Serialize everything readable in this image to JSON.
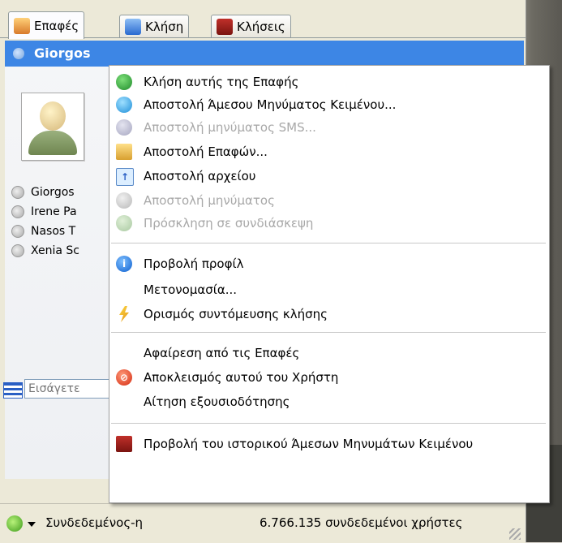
{
  "tabs": [
    {
      "label": "Επαφές",
      "icon": "contacts-icon",
      "active": true
    },
    {
      "label": "Κλήση",
      "icon": "dialpad-icon",
      "active": false
    },
    {
      "label": "Κλήσεις",
      "icon": "call-history-icon",
      "active": false
    }
  ],
  "selected_contact": "Giorgos",
  "contacts": [
    "Giorgos",
    "Irene Pa",
    "Nasos T",
    "Xenia Sc"
  ],
  "search": {
    "placeholder": "Εισάγετε"
  },
  "context_menu": {
    "items": [
      {
        "label": "Κλήση αυτής της Επαφής",
        "icon": "call-icon",
        "enabled": true
      },
      {
        "label": "Αποστολή Άμεσου Μηνύματος Κειμένου...",
        "icon": "chat-icon",
        "enabled": true
      },
      {
        "label": "Αποστολή μηνύματος SMS...",
        "icon": "sms-icon",
        "enabled": false
      },
      {
        "label": "Αποστολή Επαφών...",
        "icon": "send-contacts-icon",
        "enabled": true
      },
      {
        "label": "Αποστολή αρχείου",
        "icon": "send-file-icon",
        "enabled": true
      },
      {
        "label": "Αποστολή μηνύματος",
        "icon": "voicemail-icon",
        "enabled": false
      },
      {
        "label": "Πρόσκληση σε συνδιάσκεψη",
        "icon": "conference-icon",
        "enabled": false
      },
      {
        "label": "Προβολή προφίλ",
        "icon": "info-icon",
        "enabled": true
      },
      {
        "label": "Μετονομασία...",
        "icon": "",
        "enabled": true
      },
      {
        "label": "Ορισμός συντόμευσης κλήσης",
        "icon": "speed-dial-icon",
        "enabled": true
      },
      {
        "label": "Αφαίρεση από τις Επαφές",
        "icon": "",
        "enabled": true
      },
      {
        "label": "Αποκλεισμός αυτού του Χρήστη",
        "icon": "block-icon",
        "enabled": true
      },
      {
        "label": "Αίτηση εξουσιοδότησης",
        "icon": "",
        "enabled": true
      },
      {
        "label": "Προβολή του ιστορικού Άμεσων Μηνυμάτων Κειμένου",
        "icon": "history-book-icon",
        "enabled": true
      }
    ]
  },
  "status": {
    "state": "Συνδεδεμένος-η",
    "users_online": "6.766.135 συνδεδεμένοι χρήστες"
  }
}
